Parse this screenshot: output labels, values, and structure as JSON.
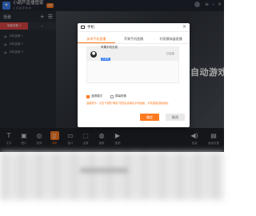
{
  "app": {
    "name": "小葫芦直播管家",
    "subtitle": "让 直 播 更 简 单",
    "vip_badge": "VIP",
    "user_name": "",
    "minimize_icon": "minimize-icon",
    "close_icon": "close-icon"
  },
  "sidebar": {
    "title": "场景",
    "tabs": [
      {
        "label": "场景切换 1"
      },
      {
        "label": "+"
      }
    ],
    "items": [
      {
        "label": "手机投屏 1"
      },
      {
        "label": "手机投屏 2"
      },
      {
        "label": "手机投屏 3"
      }
    ]
  },
  "preview": {
    "overlay_text": "自动游戏"
  },
  "toolbar": {
    "tools": [
      {
        "label": "文字",
        "icon": "text-icon"
      },
      {
        "label": "图片",
        "icon": "image-icon"
      },
      {
        "label": "游戏",
        "icon": "gamepad-icon"
      },
      {
        "label": "手机",
        "icon": "phone-icon"
      },
      {
        "label": "窗口",
        "icon": "monitor-icon"
      },
      {
        "label": "全屏",
        "icon": "screen-icon"
      },
      {
        "label": "摄像",
        "icon": "camera-icon"
      },
      {
        "label": "视频",
        "icon": "video-icon"
      }
    ],
    "right_tools": [
      {
        "label": "音量",
        "icon": "speaker-icon"
      },
      {
        "label": "画面设置",
        "icon": "settings-icon"
      }
    ]
  },
  "modal": {
    "title": "手机",
    "close_glyph": "×",
    "tabs": [
      {
        "label": "安卓手机直播"
      },
      {
        "label": "苹果手机直播"
      },
      {
        "label": "利用模拟器直播"
      }
    ],
    "device": {
      "name": "苹果手机无线",
      "status": "已连接",
      "action": "已连接"
    },
    "options": [
      {
        "label": "竖屏模式",
        "checked": true
      },
      {
        "label": "屏幕镜像",
        "checked": false
      }
    ],
    "tip": "温馨提示：点击下面的\"确定\"按钮后会弹出手机画面，手机直接连接画面。",
    "buttons": {
      "ok": "确定",
      "cancel": "取消"
    }
  },
  "colors": {
    "accent": "#ff7a21",
    "brand": "#3d7ff0",
    "active_tab": "#d94444"
  }
}
